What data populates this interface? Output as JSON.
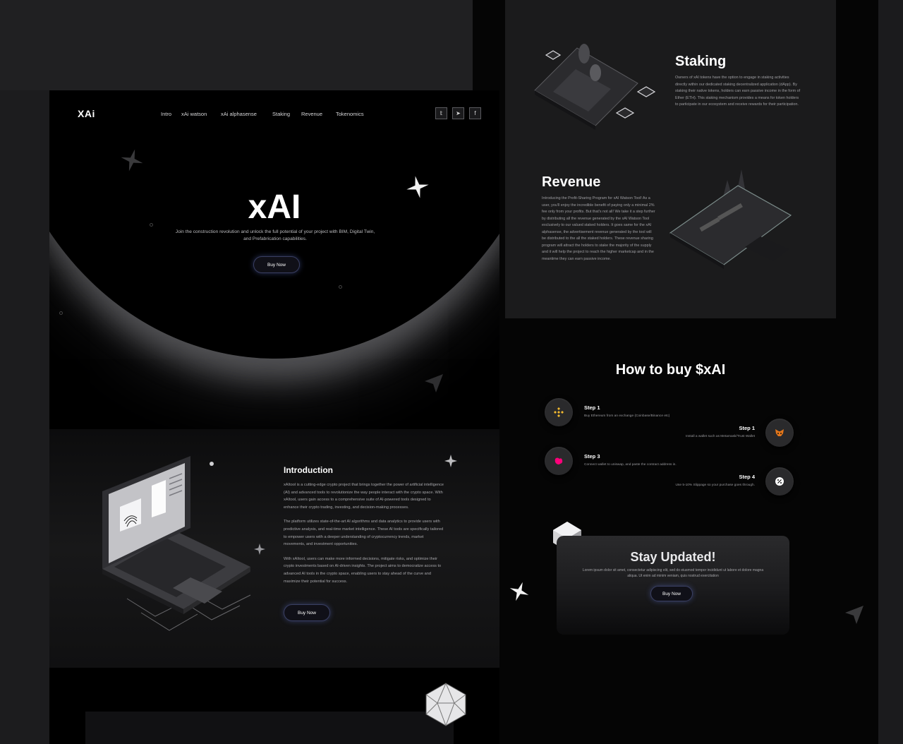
{
  "header": {
    "logo": "XAi",
    "nav": [
      "Intro",
      "xAi watson",
      "xAi alphasense",
      "Staking",
      "Revenue",
      "Tokenomics"
    ],
    "social_icons": [
      "twitter-icon",
      "telegram-icon",
      "facebook-icon"
    ],
    "social_glyphs": [
      "𝕥",
      "➤",
      "f"
    ]
  },
  "hero": {
    "title": "xAI",
    "subtitle": "Join the construction revolution and unlock the full potential of your project with BIM, Digital Twin, and Prefabrication capabilities.",
    "button": "Buy Now"
  },
  "introduction": {
    "title": "Introduction",
    "paragraphs": [
      "xAItool is a cutting-edge crypto project that brings together the power of artificial intelligence (AI) and advanced tools to revolutionize the way people interact with the crypto space. With xAItool, users gain access to a comprehensive suite of AI-powered tools designed to enhance their crypto trading, investing, and decision-making processes.",
      "The platform utilizes state-of-the-art AI algorithms and data analytics to provide users with predictive analysis, and real-time market intelligence. These AI tools are specifically tailored to empower users with a deeper understanding of cryptocurrency trends, market movements, and investment opportunities.",
      "With xAItool, users can make more informed decisions, mitigate risks, and optimize their crypto investments based on AI-driven insights. The project aims to democratize access to advanced AI tools in the crypto space, enabling users to stay ahead of the curve and maximize their potential for success."
    ],
    "button": "Buy Now"
  },
  "staking": {
    "title": "Staking",
    "text": "Owners of xAI tokens have the option to engage in staking activities directly within our dedicated staking decentralized application (dApp). By staking their native tokens, holders can earn passive income in the form of Ether (ETH). This staking mechanism provides a means for token holders to participate in our ecosystem and receive rewards for their participation."
  },
  "revenue": {
    "title": "Revenue",
    "text": "Introducing the Profit-Sharing Program for xAI Watson Tool! As a user, you'll enjoy the incredible benefit of paying only a minimal 2% fee only from your profits. But that's not all! We take it a step further by distributing all the revenue generated by the xAI Watson Tool exclusively to our valued staked holders. It goes same for the xAI alphasense, the advertisement revenue generated by the tool will be distributed to the all the staked holders. These revenue sharing program will attract the holders to stake the majority of the supply and it will help the project to reach the higher marketcap and in the meantime they can earn passive income."
  },
  "how_to_buy": {
    "title": "How to buy $xAI",
    "steps": [
      {
        "title": "Step 1",
        "desc": "Buy Ethereum from an exchange (Coinbase/Binance etc)",
        "icon": "binance-icon"
      },
      {
        "title": "Step 1",
        "desc": "Install a wallet such as Metamask/Trust Wallet",
        "icon": "metamask-icon"
      },
      {
        "title": "Step 3",
        "desc": "Connect wallet to uniswap, and paste the contract address in.",
        "icon": "uniswap-icon"
      },
      {
        "title": "Step 4",
        "desc": "Use 5-10% Slippage so your purchase goes through.",
        "icon": "percent-icon"
      }
    ]
  },
  "stay_updated": {
    "title": "Stay Updated!",
    "text": "Lorem ipsum dolor sit amet, consectetur adipiscing elit, sed do eiusmod tempor incididunt ut labore et dolore magna aliqua. Ut enim ad minim veniam, quis nostrud exercitation",
    "button": "Buy Now"
  },
  "colors": {
    "background": "#1c1c1e",
    "panel_black": "#000000",
    "panel_dark": "#1b1b1c",
    "button_glow": "#3a3f62",
    "binance": "#f3ba2f",
    "metamask": "#e2761b",
    "uniswap": "#ff007a"
  }
}
